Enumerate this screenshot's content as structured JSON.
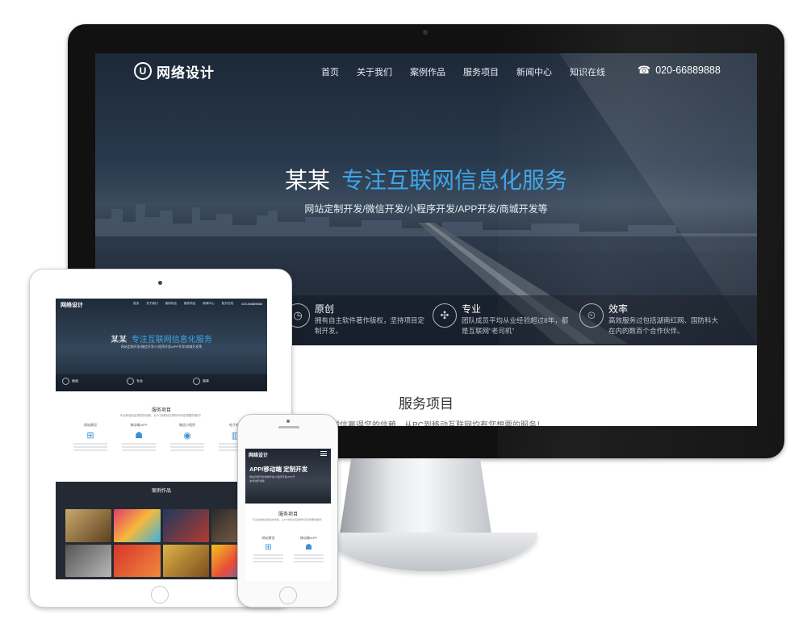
{
  "site": {
    "logo_text": "网络设计",
    "logo_letter": "U",
    "nav": [
      "首页",
      "关于我们",
      "案例作品",
      "服务项目",
      "新闻中心",
      "知识在线"
    ],
    "phone": "020-66889888",
    "phone_icon": "phone-icon",
    "hero": {
      "brand": "某某",
      "slogan": "专注互联网信息化服务",
      "subtitle": "网站定制开发/微信开发/小程序开发/APP开发/商城开发等"
    },
    "features": [
      {
        "title": "原创",
        "desc": "拥有自主软件著作版权，坚持项目定制开发。",
        "icon": "clock-icon"
      },
      {
        "title": "专业",
        "desc": "团队成员平均从业经验超过8年，都是互联网“老司机”",
        "icon": "puzzle-icon"
      },
      {
        "title": "效率",
        "desc": "高效服务过包括湖南红网、国防科大在内的数百个合作伙伴。",
        "icon": "alarm-icon"
      }
    ],
    "services": {
      "title": "服务项目",
      "subtitle": "专业和诚信赢得您的信赖，从PC到移动互联网均有您想要的服务！"
    }
  },
  "tablet": {
    "services": [
      "网站建设",
      "移动端/APP",
      "微信小程序",
      "电子商务"
    ],
    "cases_title": "案例作品"
  },
  "phone": {
    "hero_title": "APP/移动端 定制开发",
    "services": [
      "网站建设",
      "移动端/APP"
    ]
  },
  "colors": {
    "accent": "#3ea6e8",
    "hero_dark": "#1f2c3c",
    "bezel": "#111111"
  }
}
